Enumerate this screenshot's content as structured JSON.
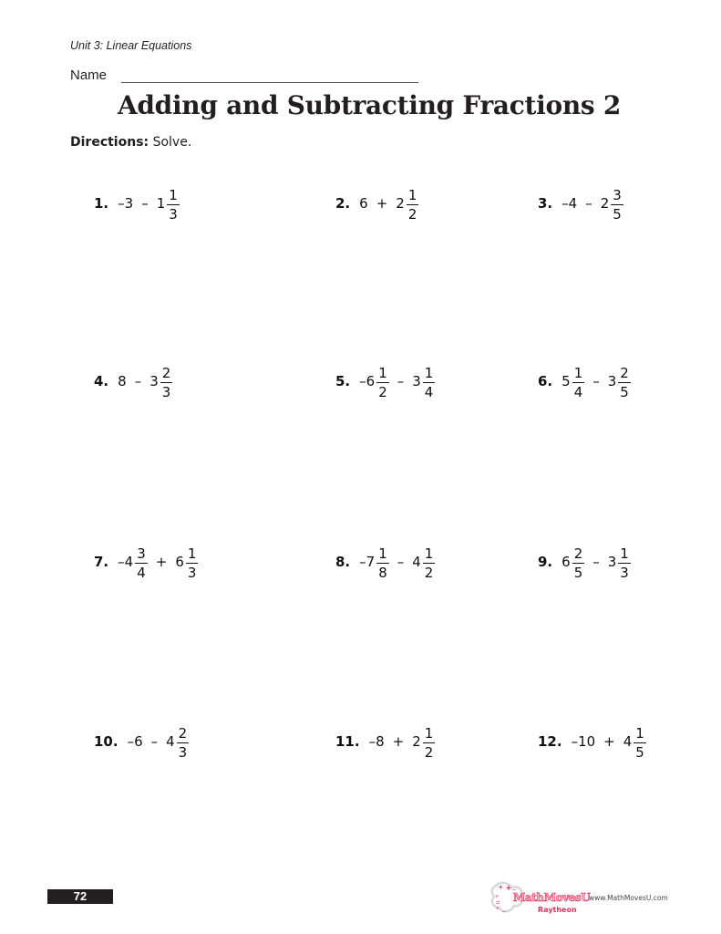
{
  "header": {
    "unit": "Unit 3: Linear Equations",
    "name_label": "Name"
  },
  "title": "Adding and Subtracting Fractions 2",
  "directions": {
    "label": "Directions:",
    "text": "Solve."
  },
  "problems": [
    {
      "num": "1.",
      "a": {
        "sign": "–",
        "whole": "3"
      },
      "op": "–",
      "b": {
        "whole": "1",
        "n": "1",
        "d": "3"
      }
    },
    {
      "num": "2.",
      "a": {
        "whole": "6"
      },
      "op": "+",
      "b": {
        "whole": "2",
        "n": "1",
        "d": "2"
      }
    },
    {
      "num": "3.",
      "a": {
        "sign": "–",
        "whole": "4"
      },
      "op": "–",
      "b": {
        "whole": "2",
        "n": "3",
        "d": "5"
      }
    },
    {
      "num": "4.",
      "a": {
        "whole": "8"
      },
      "op": "–",
      "b": {
        "whole": "3",
        "n": "2",
        "d": "3"
      }
    },
    {
      "num": "5.",
      "a": {
        "sign": "–",
        "whole": "6",
        "n": "1",
        "d": "2"
      },
      "op": "–",
      "b": {
        "whole": "3",
        "n": "1",
        "d": "4"
      }
    },
    {
      "num": "6.",
      "a": {
        "whole": "5",
        "n": "1",
        "d": "4"
      },
      "op": "–",
      "b": {
        "whole": "3",
        "n": "2",
        "d": "5"
      }
    },
    {
      "num": "7.",
      "a": {
        "sign": "–",
        "whole": "4",
        "n": "3",
        "d": "4"
      },
      "op": "+",
      "b": {
        "whole": "6",
        "n": "1",
        "d": "3"
      }
    },
    {
      "num": "8.",
      "a": {
        "sign": "–",
        "whole": "7",
        "n": "1",
        "d": "8"
      },
      "op": "–",
      "b": {
        "whole": "4",
        "n": "1",
        "d": "2"
      }
    },
    {
      "num": "9.",
      "a": {
        "whole": "6",
        "n": "2",
        "d": "5"
      },
      "op": "–",
      "b": {
        "whole": "3",
        "n": "1",
        "d": "3"
      }
    },
    {
      "num": "10.",
      "a": {
        "sign": "–",
        "whole": "6"
      },
      "op": "–",
      "b": {
        "whole": "4",
        "n": "2",
        "d": "3"
      }
    },
    {
      "num": "11.",
      "a": {
        "sign": "–",
        "whole": "8"
      },
      "op": "+",
      "b": {
        "whole": "2",
        "n": "1",
        "d": "2"
      }
    },
    {
      "num": "12.",
      "a": {
        "sign": "–",
        "whole": "10"
      },
      "op": "+",
      "b": {
        "whole": "4",
        "n": "1",
        "d": "5"
      }
    }
  ],
  "footer": {
    "page_number": "72",
    "logo_text": "MathMovesU",
    "logo_sub": "Raytheon",
    "url": "www.MathMovesU.com",
    "logo_color": "#e0335c"
  }
}
